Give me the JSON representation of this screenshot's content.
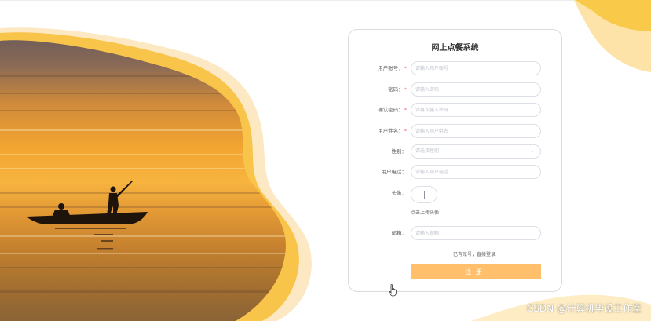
{
  "form": {
    "title": "网上点餐系统",
    "fields": [
      {
        "label": "用户账号",
        "required": true,
        "placeholder": "请输入用户账号",
        "type": "text"
      },
      {
        "label": "密码",
        "required": true,
        "placeholder": "请输入密码",
        "type": "password"
      },
      {
        "label": "确认密码",
        "required": true,
        "placeholder": "请再次输入密码",
        "type": "password"
      },
      {
        "label": "用户姓名",
        "required": true,
        "placeholder": "请输入用户姓名",
        "type": "text"
      },
      {
        "label": "性别",
        "required": false,
        "placeholder": "请选择性别",
        "type": "select"
      },
      {
        "label": "用户电话",
        "required": false,
        "placeholder": "请输入用户电话",
        "type": "text"
      }
    ],
    "avatar": {
      "label": "头像",
      "hint": "点击上传头像"
    },
    "email": {
      "label": "邮箱",
      "placeholder": "请输入邮箱"
    },
    "label_suffix": "：",
    "required_mark": "*",
    "login_link": "已有账号，直接登录",
    "register_label": "注册"
  },
  "watermark": "CSDN @计算机毕设工作室",
  "colors": {
    "accent": "#ffbf6b",
    "required": "#f56c6c",
    "blob_light": "#fde8c4",
    "blob_mid": "#fbd27e",
    "blob_strong": "#f8c54a"
  },
  "icons": {
    "upload": "plus-icon",
    "select": "chevron-down-icon",
    "cursor": "hand-pointer-icon"
  }
}
